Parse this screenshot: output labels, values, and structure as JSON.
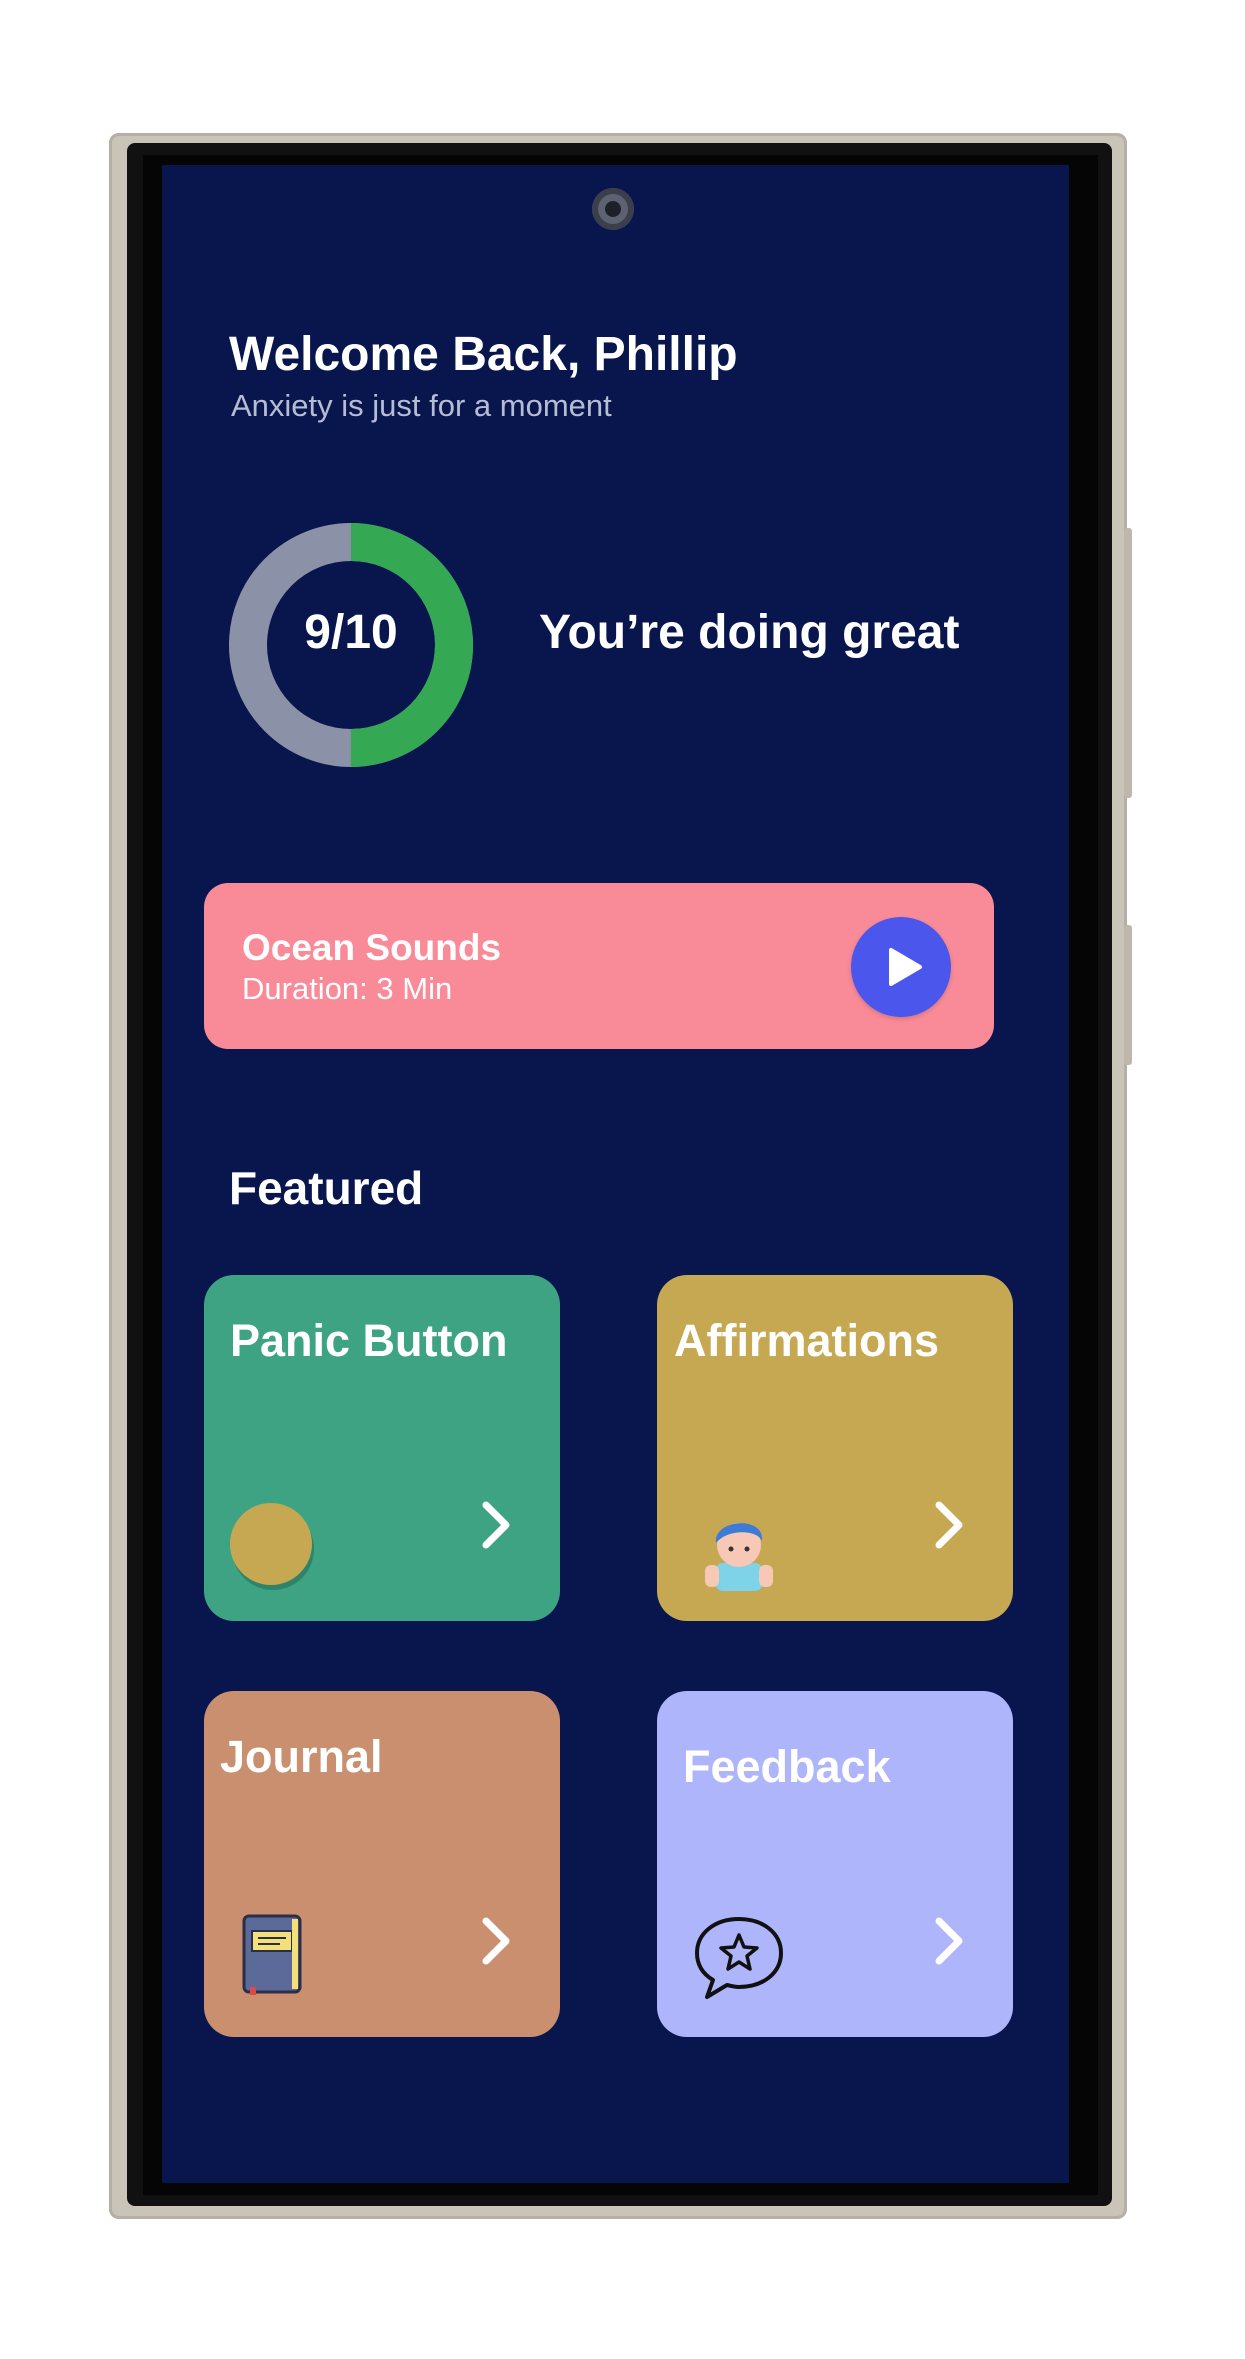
{
  "header": {
    "title": "Welcome Back, Phillip",
    "subtitle": "Anxiety is just for a moment"
  },
  "score": {
    "value_label": "9/10",
    "value": 9,
    "max": 10,
    "status": "You’re doing great",
    "fill_color": "#34a853",
    "track_color": "#8b92a8"
  },
  "player": {
    "title": "Ocean Sounds",
    "duration": "Duration: 3 Min",
    "play_icon": "play-icon",
    "color": "#f98a98"
  },
  "featured": {
    "title": "Featured",
    "cards": [
      {
        "label": "Panic Button",
        "icon": "circle-button-icon",
        "color": "#3ea383"
      },
      {
        "label": "Affirmations",
        "icon": "person-icon",
        "color": "#c6a852"
      },
      {
        "label": "Journal",
        "icon": "notebook-icon",
        "color": "#c98f6f"
      },
      {
        "label": "Feedback",
        "icon": "star-speech-bubble-icon",
        "color": "#aeb5fb"
      }
    ]
  },
  "colors": {
    "background": "#08164d",
    "play_button": "#4b56ec"
  }
}
